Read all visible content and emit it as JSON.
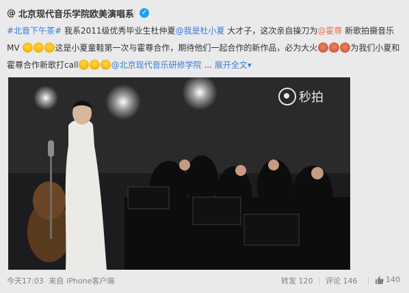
{
  "post": {
    "author_prefix": "@",
    "author": "北京现代音乐学院欧美演唱系",
    "verified_icon": "verified-badge-icon",
    "text": {
      "hashtag": "#北音下午茶#",
      "t1": " 我系2011级优秀毕业生杜仲夏",
      "mention1": "@我是杜小夏",
      "t2": " 大才子，这次亲自操刀为",
      "mention2": "@霍尊",
      "t3": " 新歌拍摄音乐MV",
      "t4": "这是小夏童鞋第一次与霍尊合作，期待他们一起合作的新作品，必为大火",
      "t5": "为我们小夏和霍尊合作新歌打call",
      "mention3": "@北京现代音乐研修学院",
      "dots": " ... ",
      "expand": "展开全文",
      "expand_arrow": "▾"
    }
  },
  "video": {
    "watermark": "秒拍"
  },
  "footer": {
    "time": "今天17:03",
    "source_prefix": "来自",
    "source": "iPhone客户端",
    "repost_label": "转发",
    "repost_count": "120",
    "comment_label": "评论",
    "comment_count": "146",
    "like_count": "140",
    "like_icon": "thumbs-up-icon"
  },
  "colors": {
    "accent": "#eb7350",
    "link": "#3a7bd5",
    "background": "#eaeaec"
  }
}
